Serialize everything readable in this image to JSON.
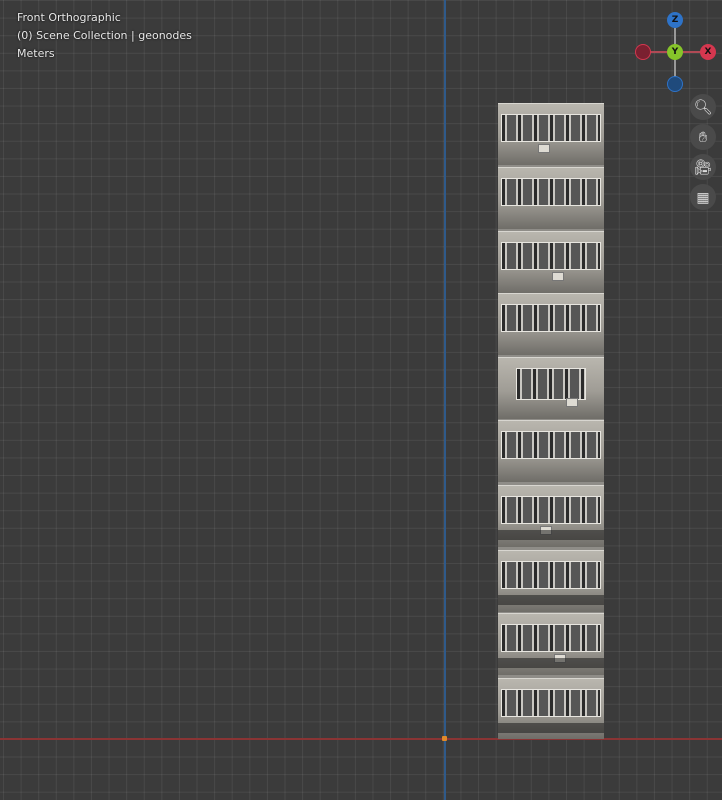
{
  "viewport": {
    "view_name": "Front Orthographic",
    "collection_info": "(0) Scene Collection | geonodes",
    "units": "Meters"
  },
  "gizmo": {
    "z_label": "Z",
    "y_label": "Y",
    "x_label": "X",
    "colors": {
      "x": "#d5374f",
      "y": "#86c42a",
      "z": "#2e73c8"
    }
  },
  "tools": [
    {
      "name": "zoom",
      "icon": "zoom-icon"
    },
    {
      "name": "pan",
      "icon": "hand-icon"
    },
    {
      "name": "camera",
      "icon": "camera-icon"
    },
    {
      "name": "ortho",
      "icon": "grid-icon"
    }
  ],
  "axis_colors": {
    "x_axis": "#8a3434",
    "z_axis": "#2f5a8a",
    "origin": "#e08a2a"
  }
}
